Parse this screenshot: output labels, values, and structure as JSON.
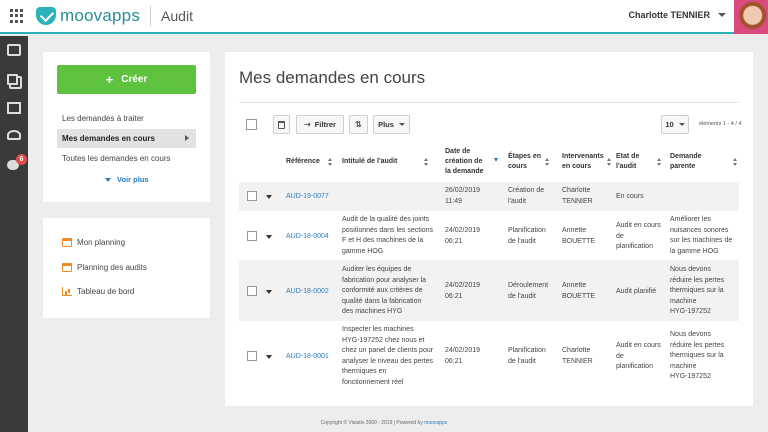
{
  "header": {
    "brand": "moovapps",
    "app_title": "Audit",
    "user_name": "Charlotte TENNIER"
  },
  "leftnav": {
    "badge_count": "6"
  },
  "sidebar": {
    "create_label": "Créer",
    "items": [
      {
        "label": "Les demandes à traiter"
      },
      {
        "label": "Mes demandes en cours"
      },
      {
        "label": "Toutes les demandes en cours"
      }
    ],
    "voir_plus": "Voir plus",
    "links": [
      {
        "label": "Mon planning",
        "icon": "calendar-icon"
      },
      {
        "label": "Planning des audits",
        "icon": "calendar-icon"
      },
      {
        "label": "Tableau de bord",
        "icon": "bar-chart-icon"
      }
    ]
  },
  "main": {
    "title": "Mes demandes en cours",
    "toolbar": {
      "filter_label": "Filtrer",
      "more_label": "Plus",
      "page_size": "10",
      "elements_info": "éléments 1 - 4 / 4"
    },
    "columns": {
      "reference": "Référence",
      "intitule": "Intitulé de l'audit",
      "date": [
        "Date de",
        "création de",
        "la demande"
      ],
      "etapes": [
        "Étapes en",
        "cours"
      ],
      "intervenants": [
        "Intervenants",
        "en cours"
      ],
      "etat": [
        "Etat de",
        "l'audit"
      ],
      "parente": [
        "Demande",
        "parente"
      ]
    },
    "rows": [
      {
        "reference": "AUD-19-0077",
        "intitule": [],
        "date": [
          "26/02/2019",
          "11:49"
        ],
        "etape": [
          "Création de",
          "l'audit"
        ],
        "intervenant": [
          "Charlotte",
          "TENNIER"
        ],
        "etat": [
          "En cours"
        ],
        "parente": []
      },
      {
        "reference": "AUD-18-0004",
        "intitule": [
          "Audit de la qualité des joints",
          "positionnés dans les sections",
          "F et H des machines de la",
          "gamme HOG"
        ],
        "date": [
          "24/02/2019",
          "06:21"
        ],
        "etape": [
          "Planification",
          "de l'audit"
        ],
        "intervenant": [
          "Annette",
          "BOUETTE"
        ],
        "etat": [
          "Audit en cours",
          "de",
          "planification"
        ],
        "parente": [
          "Améliorer les",
          "nuisances sonores",
          "sur les machines de",
          "la gamme HOG"
        ]
      },
      {
        "reference": "AUD-18-0002",
        "intitule": [
          "Auditer les équipes de",
          "fabrication pour analyser la",
          "conformité aux critères de",
          "qualité dans la fabrication",
          "des machines HYG"
        ],
        "date": [
          "24/02/2019",
          "06:21"
        ],
        "etape": [
          "Déroulement",
          "de l'audit"
        ],
        "intervenant": [
          "Annette",
          "BOUETTE"
        ],
        "etat": [
          "Audit planifié"
        ],
        "parente": [
          "Nous devons",
          "réduire les pertes",
          "thermiques sur la",
          "machine",
          "HYG-197252"
        ]
      },
      {
        "reference": "AUD-18-0001",
        "intitule": [
          "Inspecter les machines",
          "HYG-197252 chez nous et",
          "chez un panel de clients pour",
          "analyser le niveau des pertes",
          "thermiques en",
          "fonctionnement réel"
        ],
        "date": [
          "24/02/2019",
          "06:21"
        ],
        "etape": [
          "Planification",
          "de l'audit"
        ],
        "intervenant": [
          "Charlotte",
          "TENNIER"
        ],
        "etat": [
          "Audit en cours",
          "de",
          "planification"
        ],
        "parente": [
          "Nous devons",
          "réduire les pertes",
          "thermiques sur la",
          "machine",
          "HYG-197252"
        ]
      }
    ]
  },
  "footer": {
    "text": "Copyright © Visiativ 2000 - 2019 | Powered by",
    "brand": "moovapps"
  }
}
